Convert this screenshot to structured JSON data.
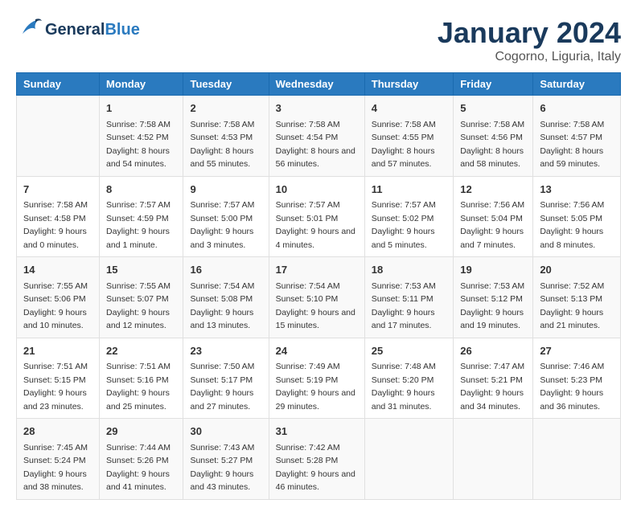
{
  "header": {
    "logo_general": "General",
    "logo_blue": "Blue",
    "month": "January 2024",
    "location": "Cogorno, Liguria, Italy"
  },
  "weekdays": [
    "Sunday",
    "Monday",
    "Tuesday",
    "Wednesday",
    "Thursday",
    "Friday",
    "Saturday"
  ],
  "weeks": [
    [
      {
        "day": "",
        "sunrise": "",
        "sunset": "",
        "daylight": ""
      },
      {
        "day": "1",
        "sunrise": "Sunrise: 7:58 AM",
        "sunset": "Sunset: 4:52 PM",
        "daylight": "Daylight: 8 hours and 54 minutes."
      },
      {
        "day": "2",
        "sunrise": "Sunrise: 7:58 AM",
        "sunset": "Sunset: 4:53 PM",
        "daylight": "Daylight: 8 hours and 55 minutes."
      },
      {
        "day": "3",
        "sunrise": "Sunrise: 7:58 AM",
        "sunset": "Sunset: 4:54 PM",
        "daylight": "Daylight: 8 hours and 56 minutes."
      },
      {
        "day": "4",
        "sunrise": "Sunrise: 7:58 AM",
        "sunset": "Sunset: 4:55 PM",
        "daylight": "Daylight: 8 hours and 57 minutes."
      },
      {
        "day": "5",
        "sunrise": "Sunrise: 7:58 AM",
        "sunset": "Sunset: 4:56 PM",
        "daylight": "Daylight: 8 hours and 58 minutes."
      },
      {
        "day": "6",
        "sunrise": "Sunrise: 7:58 AM",
        "sunset": "Sunset: 4:57 PM",
        "daylight": "Daylight: 8 hours and 59 minutes."
      }
    ],
    [
      {
        "day": "7",
        "sunrise": "Sunrise: 7:58 AM",
        "sunset": "Sunset: 4:58 PM",
        "daylight": "Daylight: 9 hours and 0 minutes."
      },
      {
        "day": "8",
        "sunrise": "Sunrise: 7:57 AM",
        "sunset": "Sunset: 4:59 PM",
        "daylight": "Daylight: 9 hours and 1 minute."
      },
      {
        "day": "9",
        "sunrise": "Sunrise: 7:57 AM",
        "sunset": "Sunset: 5:00 PM",
        "daylight": "Daylight: 9 hours and 3 minutes."
      },
      {
        "day": "10",
        "sunrise": "Sunrise: 7:57 AM",
        "sunset": "Sunset: 5:01 PM",
        "daylight": "Daylight: 9 hours and 4 minutes."
      },
      {
        "day": "11",
        "sunrise": "Sunrise: 7:57 AM",
        "sunset": "Sunset: 5:02 PM",
        "daylight": "Daylight: 9 hours and 5 minutes."
      },
      {
        "day": "12",
        "sunrise": "Sunrise: 7:56 AM",
        "sunset": "Sunset: 5:04 PM",
        "daylight": "Daylight: 9 hours and 7 minutes."
      },
      {
        "day": "13",
        "sunrise": "Sunrise: 7:56 AM",
        "sunset": "Sunset: 5:05 PM",
        "daylight": "Daylight: 9 hours and 8 minutes."
      }
    ],
    [
      {
        "day": "14",
        "sunrise": "Sunrise: 7:55 AM",
        "sunset": "Sunset: 5:06 PM",
        "daylight": "Daylight: 9 hours and 10 minutes."
      },
      {
        "day": "15",
        "sunrise": "Sunrise: 7:55 AM",
        "sunset": "Sunset: 5:07 PM",
        "daylight": "Daylight: 9 hours and 12 minutes."
      },
      {
        "day": "16",
        "sunrise": "Sunrise: 7:54 AM",
        "sunset": "Sunset: 5:08 PM",
        "daylight": "Daylight: 9 hours and 13 minutes."
      },
      {
        "day": "17",
        "sunrise": "Sunrise: 7:54 AM",
        "sunset": "Sunset: 5:10 PM",
        "daylight": "Daylight: 9 hours and 15 minutes."
      },
      {
        "day": "18",
        "sunrise": "Sunrise: 7:53 AM",
        "sunset": "Sunset: 5:11 PM",
        "daylight": "Daylight: 9 hours and 17 minutes."
      },
      {
        "day": "19",
        "sunrise": "Sunrise: 7:53 AM",
        "sunset": "Sunset: 5:12 PM",
        "daylight": "Daylight: 9 hours and 19 minutes."
      },
      {
        "day": "20",
        "sunrise": "Sunrise: 7:52 AM",
        "sunset": "Sunset: 5:13 PM",
        "daylight": "Daylight: 9 hours and 21 minutes."
      }
    ],
    [
      {
        "day": "21",
        "sunrise": "Sunrise: 7:51 AM",
        "sunset": "Sunset: 5:15 PM",
        "daylight": "Daylight: 9 hours and 23 minutes."
      },
      {
        "day": "22",
        "sunrise": "Sunrise: 7:51 AM",
        "sunset": "Sunset: 5:16 PM",
        "daylight": "Daylight: 9 hours and 25 minutes."
      },
      {
        "day": "23",
        "sunrise": "Sunrise: 7:50 AM",
        "sunset": "Sunset: 5:17 PM",
        "daylight": "Daylight: 9 hours and 27 minutes."
      },
      {
        "day": "24",
        "sunrise": "Sunrise: 7:49 AM",
        "sunset": "Sunset: 5:19 PM",
        "daylight": "Daylight: 9 hours and 29 minutes."
      },
      {
        "day": "25",
        "sunrise": "Sunrise: 7:48 AM",
        "sunset": "Sunset: 5:20 PM",
        "daylight": "Daylight: 9 hours and 31 minutes."
      },
      {
        "day": "26",
        "sunrise": "Sunrise: 7:47 AM",
        "sunset": "Sunset: 5:21 PM",
        "daylight": "Daylight: 9 hours and 34 minutes."
      },
      {
        "day": "27",
        "sunrise": "Sunrise: 7:46 AM",
        "sunset": "Sunset: 5:23 PM",
        "daylight": "Daylight: 9 hours and 36 minutes."
      }
    ],
    [
      {
        "day": "28",
        "sunrise": "Sunrise: 7:45 AM",
        "sunset": "Sunset: 5:24 PM",
        "daylight": "Daylight: 9 hours and 38 minutes."
      },
      {
        "day": "29",
        "sunrise": "Sunrise: 7:44 AM",
        "sunset": "Sunset: 5:26 PM",
        "daylight": "Daylight: 9 hours and 41 minutes."
      },
      {
        "day": "30",
        "sunrise": "Sunrise: 7:43 AM",
        "sunset": "Sunset: 5:27 PM",
        "daylight": "Daylight: 9 hours and 43 minutes."
      },
      {
        "day": "31",
        "sunrise": "Sunrise: 7:42 AM",
        "sunset": "Sunset: 5:28 PM",
        "daylight": "Daylight: 9 hours and 46 minutes."
      },
      {
        "day": "",
        "sunrise": "",
        "sunset": "",
        "daylight": ""
      },
      {
        "day": "",
        "sunrise": "",
        "sunset": "",
        "daylight": ""
      },
      {
        "day": "",
        "sunrise": "",
        "sunset": "",
        "daylight": ""
      }
    ]
  ]
}
